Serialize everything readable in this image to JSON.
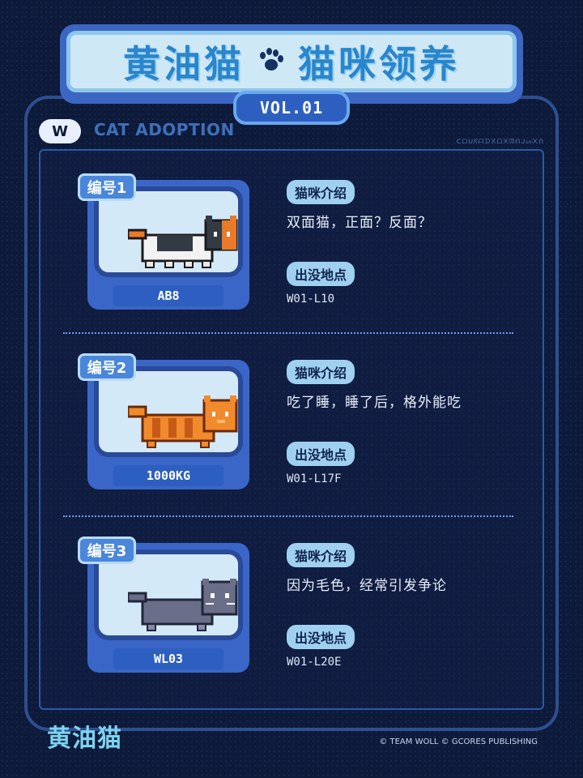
{
  "header": {
    "title_left": "黄油猫",
    "title_right": "猫咪领养",
    "volume": "VOL.01",
    "section_label": "CAT ADOPTION",
    "logo_badge": "W",
    "cipher_text": "ᑕᗝᑌᖇᗩᗪ᙭ᗝ᙭ᙏᑎᒍᔕ᙭ᑎ"
  },
  "labels": {
    "intro": "猫咪介绍",
    "location": "出没地点"
  },
  "cats": [
    {
      "tag": "编号1",
      "name": "AB8",
      "intro": "双面猫，正面？反面？",
      "location": "W01-L10",
      "colors": {
        "body": "#f2f2f2",
        "patch1": "#333a44",
        "patch2": "#e87a2a"
      }
    },
    {
      "tag": "编号2",
      "name": "1000KG",
      "intro": "吃了睡，睡了后，格外能吃",
      "location": "W01-L17F",
      "colors": {
        "body": "#f08a2c",
        "patch1": "#ffb866",
        "patch2": "#c85a18"
      }
    },
    {
      "tag": "编号3",
      "name": "WL03",
      "intro": "因为毛色，经常引发争论",
      "location": "W01-L20E",
      "colors": {
        "body": "#6a6e88",
        "patch1": "#858aa6",
        "patch2": "#4c5068"
      }
    }
  ],
  "footer": {
    "logo": "黄油猫",
    "copyright": "© TEAM WOLL  © GCORES PUBLISHING"
  }
}
